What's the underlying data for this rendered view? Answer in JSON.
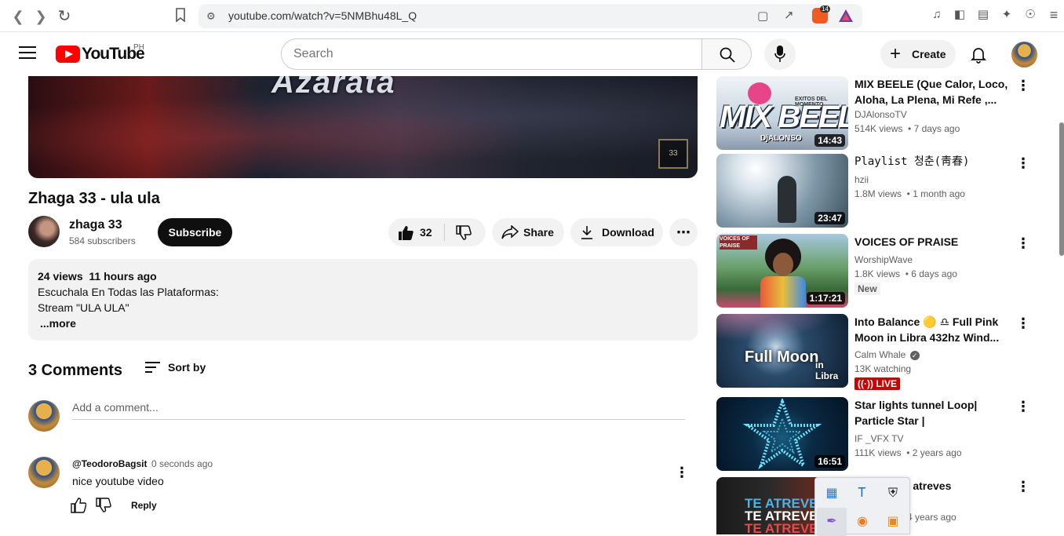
{
  "browser": {
    "url": "youtube.com/watch?v=5NMBhu48L_Q",
    "shield_count": "14"
  },
  "header": {
    "logo_text": "YouTube",
    "country_code": "PH",
    "search_placeholder": "Search",
    "create_label": "Create"
  },
  "player": {
    "art_text": "Azarata",
    "badge_text": "33"
  },
  "video": {
    "title": "Zhaga 33 - ula ula",
    "channel_name": "zhaga 33",
    "subscribers": "584 subscribers",
    "subscribe_label": "Subscribe",
    "like_count": "32",
    "share_label": "Share",
    "download_label": "Download"
  },
  "description": {
    "meta": "24 views  11 hours ago",
    "line1": "Escuchala En Todas las Plataformas:",
    "line2": "Stream \"ULA ULA\"",
    "more": "...more"
  },
  "comments": {
    "count_label": "3 Comments",
    "sort_label": "Sort by",
    "add_placeholder": "Add a comment...",
    "items": [
      {
        "author": "@TeodoroBagsit",
        "time": "0 seconds ago",
        "text": "nice youtube video",
        "reply_label": "Reply"
      }
    ]
  },
  "recommendations": [
    {
      "title": "MIX BEELE (Que Calor, Loco, Aloha, La Plena, Mi Refe ,...",
      "channel": "DJAlonsoTV",
      "meta": "514K views  • 7 days ago",
      "duration": "14:43",
      "thumb_text": "MIX BEELE",
      "thumb_small": "EXITOS DEL MOMENTO",
      "thumb_brand": "DjALONSO"
    },
    {
      "title": "Playlist 청춘(靑春)",
      "channel": "hzii",
      "meta": "1.8M views  • 1 month ago",
      "duration": "23:47"
    },
    {
      "title": "VOICES OF PRAISE",
      "channel": "WorshipWave",
      "meta": "1.8K views  • 6 days ago",
      "badge": "New",
      "duration": "1:17:21",
      "thumb_text": "VOICES OF PRAISE"
    },
    {
      "title": "Into Balance 🟡 ♎ Full Pink Moon in Libra 432hz Wind...",
      "channel": "Calm Whale",
      "meta": "13K watching",
      "badge": "LIVE",
      "thumb_text": "Full Moon",
      "thumb_small": "in Libra"
    },
    {
      "title": "Star lights tunnel Loop| Particle Star |",
      "channel": "IF _VFX TV",
      "meta": "111K views  • 2 years ago",
      "duration": "16:51"
    },
    {
      "title": "te atreves",
      "meta": "4 years ago",
      "thumb_text": "TE ATREVES"
    }
  ],
  "colors": {
    "brand_red": "#ff0000",
    "live_red": "#cc0000",
    "subscribe_bg": "#0f0f0f"
  }
}
